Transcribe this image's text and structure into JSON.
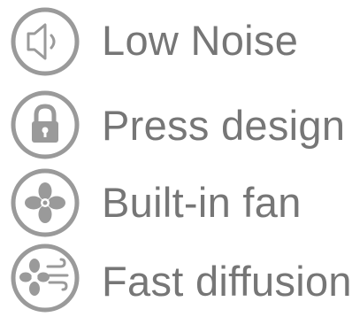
{
  "colors": {
    "icon": "#9a9a9a",
    "text": "#767676",
    "background": "#ffffff"
  },
  "features": [
    {
      "label": "Low Noise",
      "icon": "speaker-icon"
    },
    {
      "label": "Press design",
      "icon": "lock-icon"
    },
    {
      "label": "Built-in fan",
      "icon": "fan-icon"
    },
    {
      "label": "Fast diffusion",
      "icon": "diffusion-icon"
    }
  ]
}
